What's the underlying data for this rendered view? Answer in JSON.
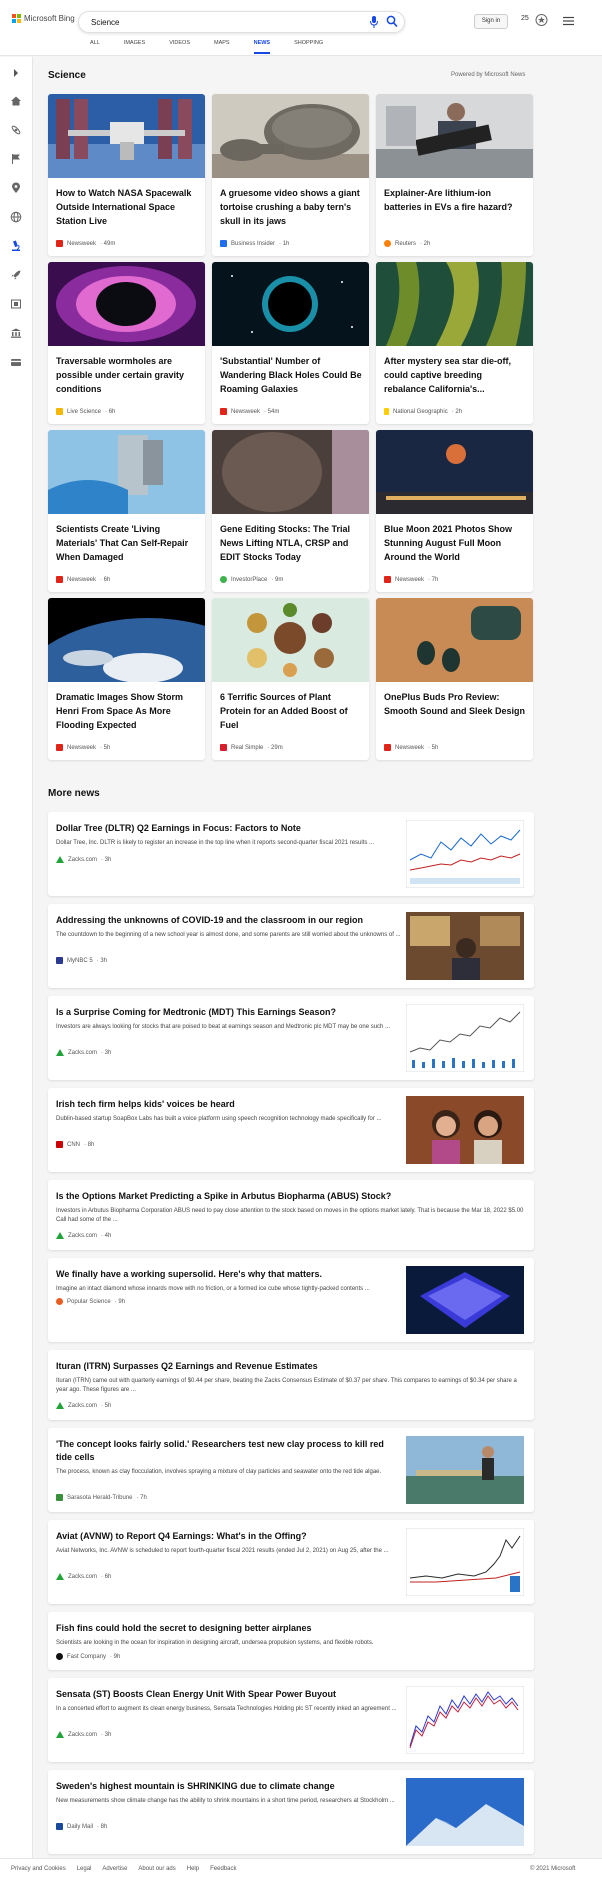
{
  "header": {
    "brand": "Microsoft Bing",
    "search_value": "Science",
    "signin_label": "Sign in",
    "rewards_points": "25",
    "tabs": [
      {
        "label": "ALL"
      },
      {
        "label": "IMAGES"
      },
      {
        "label": "VIDEOS"
      },
      {
        "label": "MAPS"
      },
      {
        "label": "NEWS",
        "active": true
      },
      {
        "label": "SHOPPING"
      }
    ]
  },
  "sidebar": {
    "icons": [
      "chevron-right-icon",
      "home-icon",
      "science-icon",
      "flag-icon",
      "location-pin-icon",
      "globe-icon",
      "microscope-icon",
      "rocket-icon",
      "film-icon",
      "bank-icon",
      "card-icon"
    ]
  },
  "section": {
    "title": "Science",
    "powered_by": "Powered by Microsoft News"
  },
  "cards": [
    {
      "title": "How to Watch NASA Spacewalk Outside International Space Station Live",
      "source": "Newsweek",
      "time": "· 49m",
      "logo_color": "#e2231a"
    },
    {
      "title": "A gruesome video shows a giant tortoise crushing a baby tern's skull in its jaws",
      "source": "Business Insider",
      "time": "· 1h",
      "logo_color": "#1f6ef0"
    },
    {
      "title": "Explainer-Are lithium-ion batteries in EVs a fire hazard?",
      "source": "Reuters",
      "time": "· 2h",
      "logo_color": "#ff8000"
    },
    {
      "title": "Traversable wormholes are possible under certain gravity conditions",
      "source": "Live Science",
      "time": "· 6h",
      "logo_color": "#f5b800"
    },
    {
      "title": "'Substantial' Number of Wandering Black Holes Could Be Roaming Galaxies",
      "source": "Newsweek",
      "time": "· 54m",
      "logo_color": "#e2231a"
    },
    {
      "title": "After mystery sea star die-off, could captive breeding rebalance California's...",
      "source": "National Geographic",
      "time": "· 2h",
      "logo_color": "#ffce00"
    },
    {
      "title": "Scientists Create 'Living Materials' That Can Self-Repair When Damaged",
      "source": "Newsweek",
      "time": "· 6h",
      "logo_color": "#e2231a"
    },
    {
      "title": "Gene Editing Stocks: The Trial News Lifting NTLA, CRSP and EDIT Stocks Today",
      "source": "InvestorPlace",
      "time": "· 9m",
      "logo_color": "#3cb44b"
    },
    {
      "title": "Blue Moon 2021 Photos Show Stunning August Full Moon Around the World",
      "source": "Newsweek",
      "time": "· 7h",
      "logo_color": "#e2231a"
    },
    {
      "title": "Dramatic Images Show Storm Henri From Space As More Flooding Expected",
      "source": "Newsweek",
      "time": "· 5h",
      "logo_color": "#e2231a"
    },
    {
      "title": "6 Terrific Sources of Plant Protein for an Added Boost of Fuel",
      "source": "Real Simple",
      "time": "· 29m",
      "logo_color": "#d81e2d"
    },
    {
      "title": "OnePlus Buds Pro Review: Smooth Sound and Sleek Design",
      "source": "Newsweek",
      "time": "· 5h",
      "logo_color": "#e2231a"
    }
  ],
  "more_news": {
    "title": "More news",
    "items": [
      {
        "title": "Dollar Tree (DLTR) Q2 Earnings in Focus: Factors to Note",
        "snippet": "Dollar Tree, Inc. DLTR is likely to register an increase in the top line when it reports second-quarter fiscal 2021 results ...",
        "source": "Zacks.com",
        "time": "· 3h",
        "logo_color": "#22a33a",
        "thumb": "chart"
      },
      {
        "title": "Addressing the unknowns of COVID-19 and the classroom in our region",
        "snippet": "The countdown to the beginning of a new school year is almost done, and some parents are still worried about the unknowns of ...",
        "source": "MyNBC 5",
        "time": "· 3h",
        "logo_color": "#2b3990",
        "thumb": "classroom"
      },
      {
        "title": "Is a Surprise Coming for Medtronic (MDT) This Earnings Season?",
        "snippet": "Investors are always looking for stocks that are poised to beat at earnings season and Medtronic plc MDT may be one such ...",
        "source": "Zacks.com",
        "time": "· 3h",
        "logo_color": "#22a33a",
        "thumb": "chart2"
      },
      {
        "title": "Irish tech firm helps kids' voices be heard",
        "snippet": "Dublin-based startup SoapBox Labs has built a voice platform using speech recognition technology made specifically for ...",
        "source": "CNN",
        "time": "· 8h",
        "logo_color": "#cc0000",
        "thumb": "kids"
      },
      {
        "title": "Is the Options Market Predicting a Spike in Arbutus Biopharma (ABUS) Stock?",
        "snippet": "Investors in Arbutus Biopharma Corporation ABUS need to pay close attention to the stock based on moves in the options market lately. That is because the Mar 18, 2022 $5.00 Call had some of the ...",
        "source": "Zacks.com",
        "time": "· 4h",
        "logo_color": "#22a33a",
        "thumb": ""
      },
      {
        "title": "We finally have a working supersolid. Here's why that matters.",
        "snippet": "Imagine an intact diamond whose innards move with no friction, or a formed ice cube whose tightly-packed contents ...",
        "source": "Popular Science",
        "time": "· 9h",
        "logo_color": "#e85d22",
        "thumb": "supersolid"
      },
      {
        "title": "Ituran (ITRN) Surpasses Q2 Earnings and Revenue Estimates",
        "snippet": "Ituran (ITRN) came out with quarterly earnings of $0.44 per share, beating the Zacks Consensus Estimate of $0.37 per share. This compares to earnings of $0.34 per share a year ago. These figures are ...",
        "source": "Zacks.com",
        "time": "· 5h",
        "logo_color": "#22a33a",
        "thumb": ""
      },
      {
        "title": "'The concept looks fairly solid.' Researchers test new clay process to kill red tide cells",
        "snippet": "The process, known as clay flocculation, involves spraying a mixture of clay particles and seawater onto the red tide algae.",
        "source": "Sarasota Herald-Tribune",
        "time": "· 7h",
        "logo_color": "#3a8f3a",
        "thumb": "dock"
      },
      {
        "title": "Aviat (AVNW) to Report Q4 Earnings: What's in the Offing?",
        "snippet": "Aviat Networks, Inc. AVNW is scheduled to report fourth-quarter fiscal 2021 results (ended Jul 2, 2021) on Aug 25, after the ...",
        "source": "Zacks.com",
        "time": "· 6h",
        "logo_color": "#22a33a",
        "thumb": "chart3"
      },
      {
        "title": "Fish fins could hold the secret to designing better airplanes",
        "snippet": "Scientists are looking in the ocean for inspiration in designing aircraft, undersea propulsion systems, and flexible robots.",
        "source": "Fast Company",
        "time": "· 9h",
        "logo_color": "#111111",
        "thumb": ""
      },
      {
        "title": "Sensata (ST) Boosts Clean Energy Unit With Spear Power Buyout",
        "snippet": "In a concerted effort to augment its clean energy business, Sensata Technologies Holding plc ST recently inked an agreement ...",
        "source": "Zacks.com",
        "time": "· 3h",
        "logo_color": "#22a33a",
        "thumb": "chart4"
      },
      {
        "title": "Sweden's highest mountain is SHRINKING due to climate change",
        "snippet": "New measurements show climate change has the ability to shrink mountains in a short time period, researchers at Stockholm ...",
        "source": "Daily Mail",
        "time": "· 8h",
        "logo_color": "#1a4b9b",
        "thumb": "mountain"
      }
    ]
  },
  "footer": {
    "links": [
      "Privacy and Cookies",
      "Legal",
      "Advertise",
      "About our ads",
      "Help",
      "Feedback"
    ],
    "copyright": "© 2021 Microsoft"
  }
}
